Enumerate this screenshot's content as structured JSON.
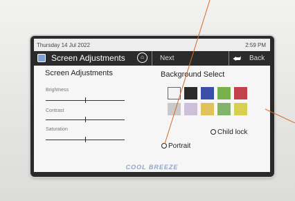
{
  "status_bar": {
    "date": "Thursday 14 Jul 2022",
    "time": "2:59 PM"
  },
  "title_bar": {
    "title": "Screen Adjustments",
    "next_label": "Next",
    "back_label": "Back"
  },
  "adjustments": {
    "heading": "Screen Adjustments",
    "sliders": [
      {
        "label": "Brightness",
        "level": 0.5
      },
      {
        "label": "Contrast",
        "level": 0.5
      },
      {
        "label": "Saturation",
        "level": 0.5
      }
    ]
  },
  "background": {
    "heading": "Background Select",
    "swatch_colors": [
      "#f4f4f4",
      "#2b2b2b",
      "#3b4fa8",
      "#79b14d",
      "#c2414c",
      "#c9c9c9",
      "#cdbfd9",
      "#e1c15b",
      "#86b36b",
      "#d8ce52"
    ],
    "selected_index": 0
  },
  "options": {
    "child_lock_label": "Child lock",
    "portrait_label": "Portrait"
  },
  "brand": "COOL BREEZE",
  "colors": {
    "accent_line": "#d46a2c",
    "title_bar": "#2b2b2b"
  }
}
